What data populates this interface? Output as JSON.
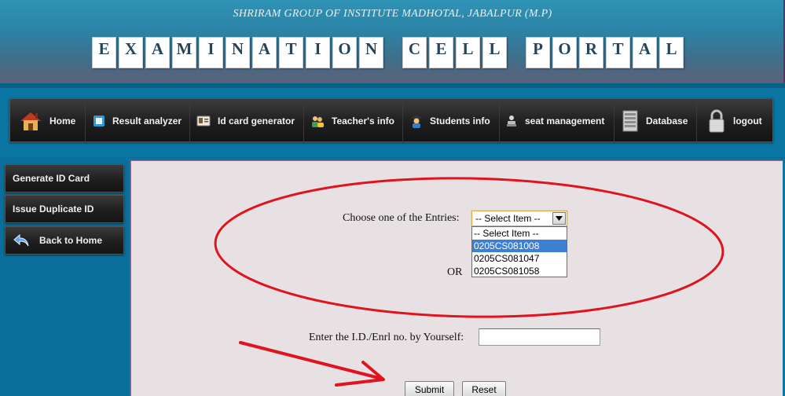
{
  "header": {
    "institute": "SHRIRAM GROUP OF INSTITUTE MADHOTAL, JABALPUR (M.P)",
    "title_letters": [
      "E",
      "X",
      "A",
      "M",
      "I",
      "N",
      "A",
      "T",
      "I",
      "O",
      "N",
      "C",
      "E",
      "L",
      "L",
      "P",
      "O",
      "R",
      "T",
      "A",
      "L"
    ],
    "title_text": "EXAMINATION CELL PORTAL"
  },
  "nav": {
    "items": [
      {
        "label": "Home",
        "icon": "house-icon"
      },
      {
        "label": "Result analyzer",
        "icon": "calculator-icon"
      },
      {
        "label": "Id card generator",
        "icon": "id-card-icon"
      },
      {
        "label": "Teacher's info",
        "icon": "teachers-group-icon"
      },
      {
        "label": "Students info",
        "icon": "student-icon"
      },
      {
        "label": "seat management",
        "icon": "seat-icon"
      },
      {
        "label": "Database",
        "icon": "database-server-icon"
      },
      {
        "label": "logout",
        "icon": "padlock-icon"
      }
    ]
  },
  "sidebar": {
    "items": [
      {
        "label": "Generate ID Card"
      },
      {
        "label": "Issue Duplicate ID"
      },
      {
        "label": "Back to Home",
        "icon": "back-arrow-icon"
      }
    ]
  },
  "form": {
    "choose_label": "Choose one of the Entries:",
    "select_value": "-- Select Item --",
    "options": [
      "-- Select Item --",
      "0205CS081008",
      "0205CS081047",
      "0205CS081058"
    ],
    "highlighted_option": "0205CS081008",
    "or_label": "OR",
    "enter_label": "Enter the I.D./Enrl no. by Yourself:",
    "id_value": "",
    "submit_label": "Submit",
    "reset_label": "Reset"
  },
  "annotation": {
    "color": "#e0141e",
    "shapes": [
      "ellipse",
      "arrow"
    ]
  }
}
